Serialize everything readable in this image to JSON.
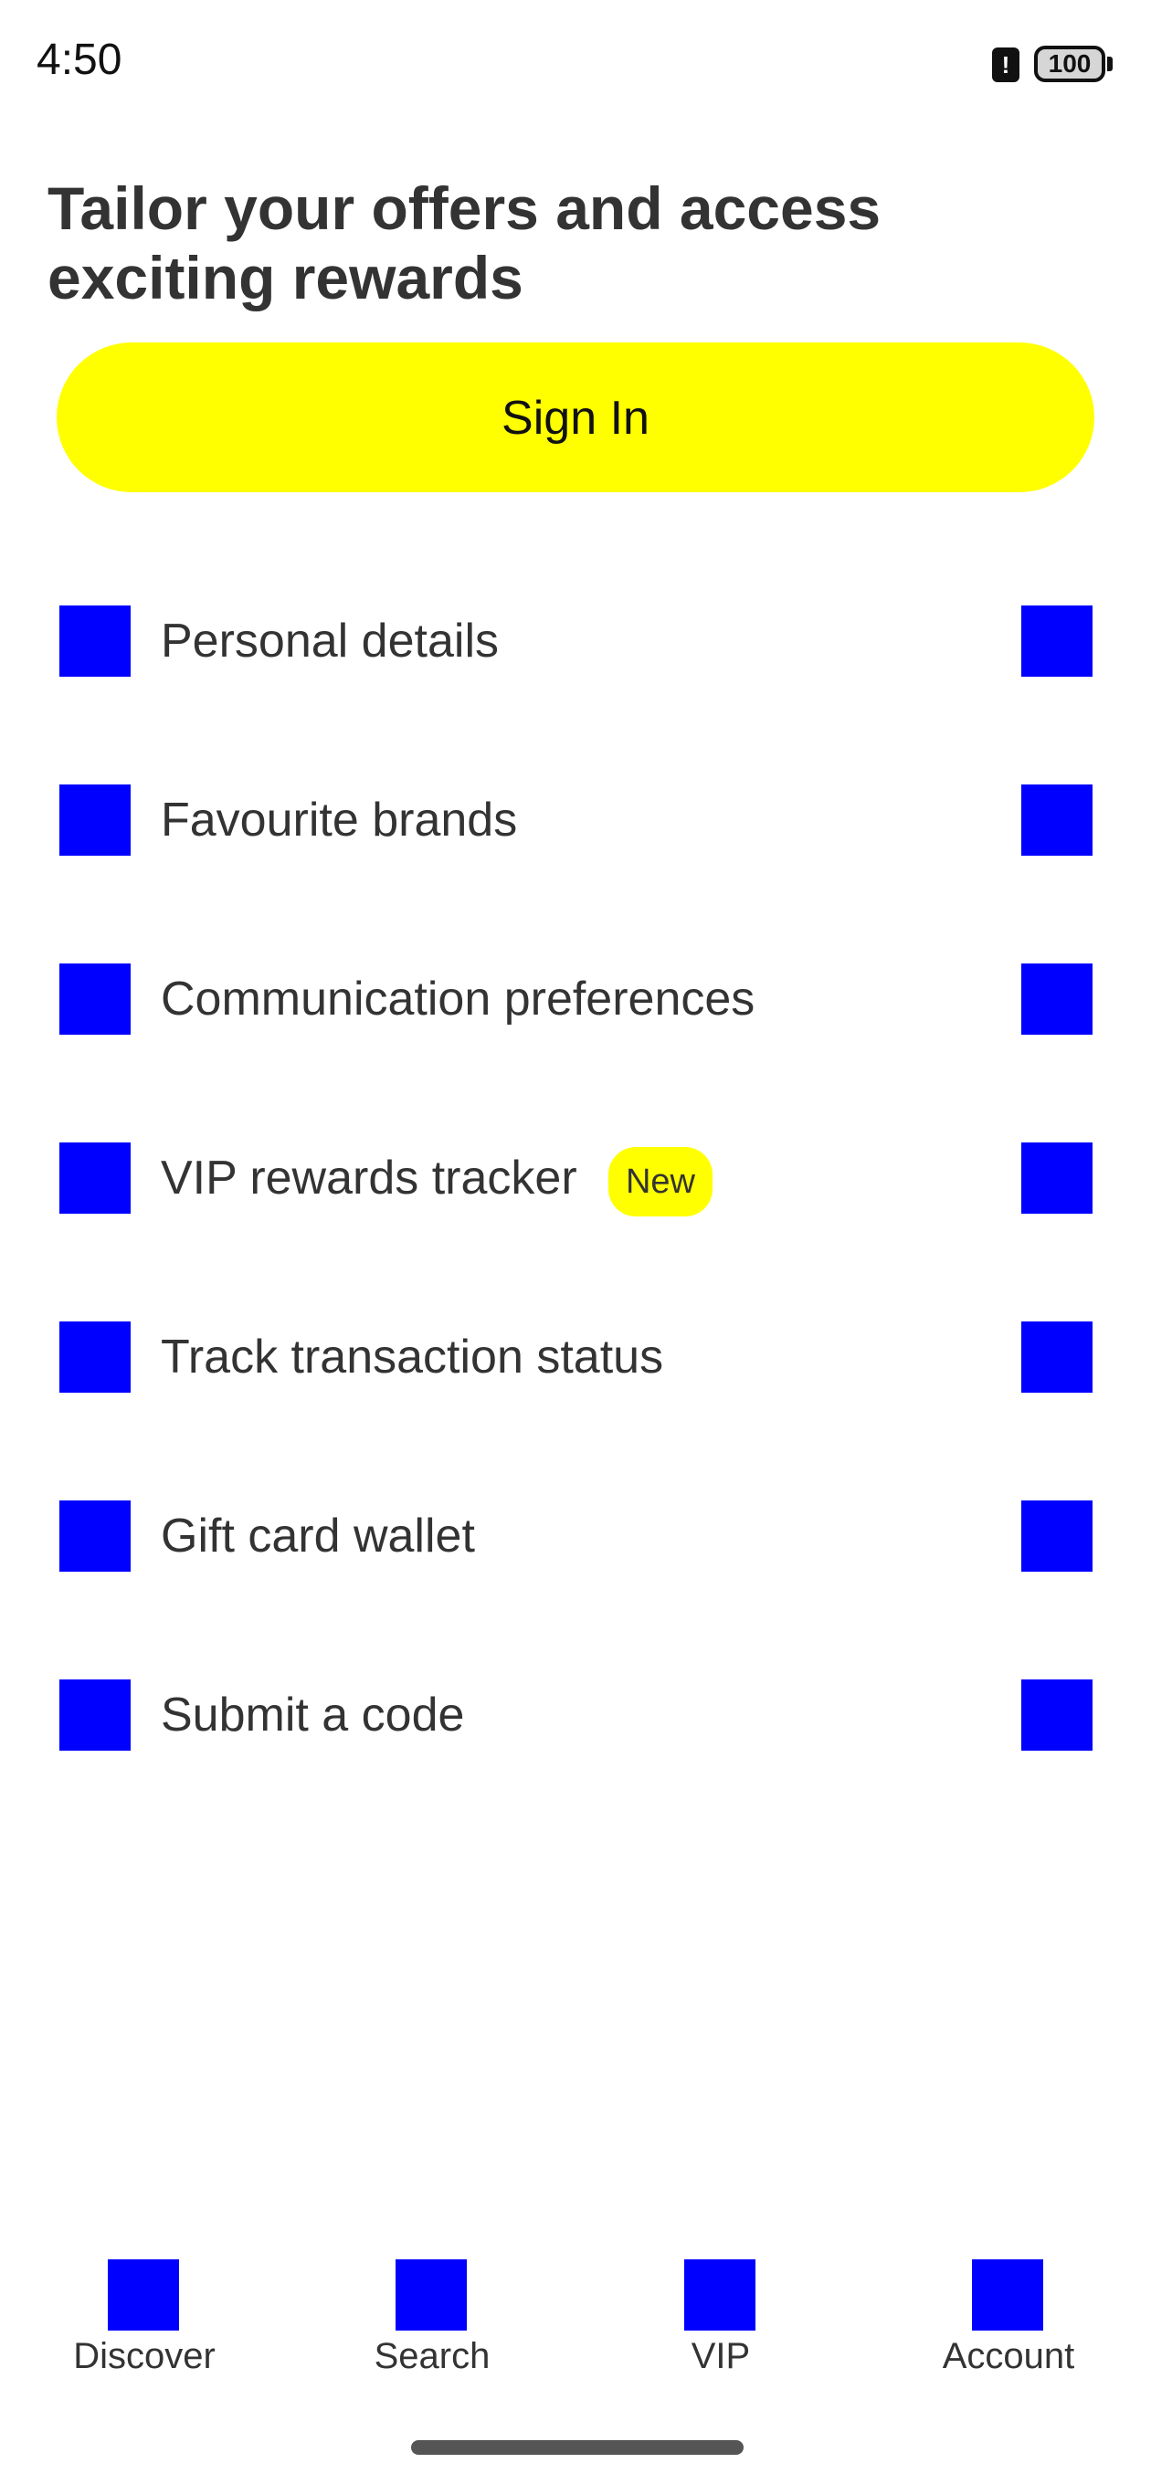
{
  "status_bar": {
    "time": "4:50",
    "alert_symbol": "!",
    "battery_level": "100"
  },
  "header": {
    "title": "Tailor your offers and access exciting rewards"
  },
  "sign_in": {
    "label": "Sign In"
  },
  "menu": {
    "items": [
      {
        "label": "Personal details",
        "badge": ""
      },
      {
        "label": "Favourite brands",
        "badge": ""
      },
      {
        "label": "Communication preferences",
        "badge": ""
      },
      {
        "label": "VIP rewards tracker",
        "badge": "New"
      },
      {
        "label": "Track transaction status",
        "badge": ""
      },
      {
        "label": "Gift card wallet",
        "badge": ""
      },
      {
        "label": "Submit a code",
        "badge": ""
      }
    ]
  },
  "bottom_nav": {
    "items": [
      {
        "label": "Discover"
      },
      {
        "label": "Search"
      },
      {
        "label": "VIP"
      },
      {
        "label": "Account"
      }
    ]
  },
  "colors": {
    "accent": "#ffff00",
    "icon_placeholder": "#0000ff",
    "text": "#333333",
    "background": "#ffffff"
  }
}
